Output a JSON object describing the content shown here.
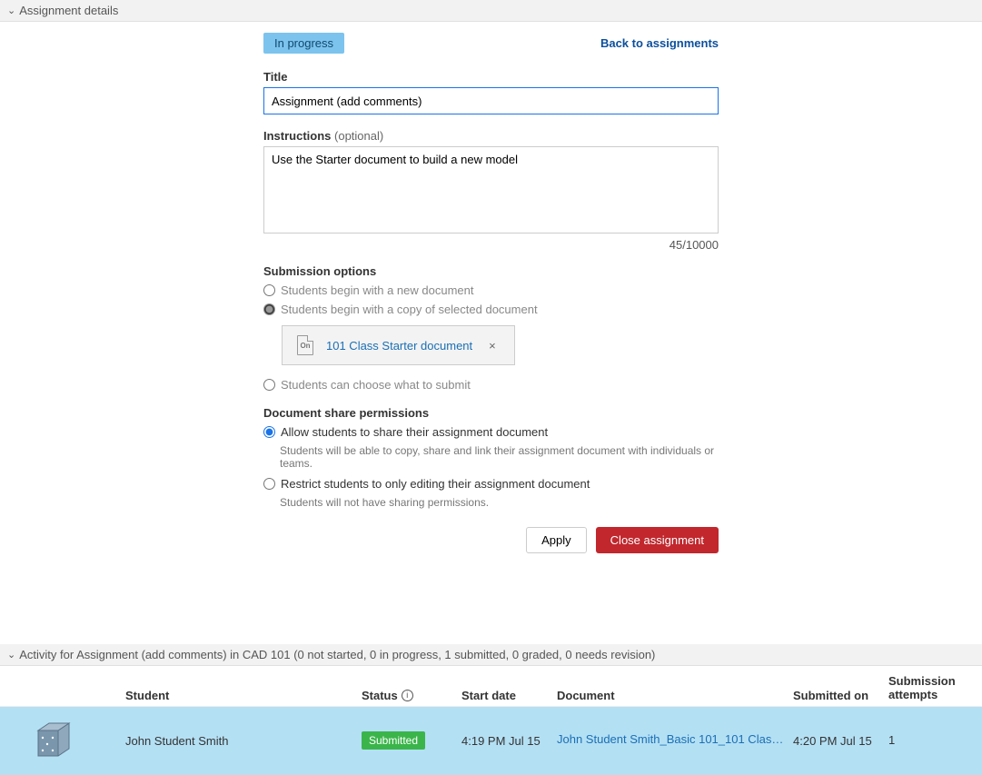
{
  "details": {
    "section_title": "Assignment details",
    "status_chip": "In progress",
    "back_link": "Back to assignments",
    "title_label": "Title",
    "title_value": "Assignment (add comments)",
    "instructions_label": "Instructions",
    "instructions_optional": " (optional)",
    "instructions_value": "Use the Starter document to build a new model",
    "char_count": "45/10000",
    "submission_label": "Submission options",
    "opt_new": "Students begin with a new document",
    "opt_copy": "Students begin with a copy of selected document",
    "opt_choose": "Students can choose what to submit",
    "selected_doc_name": "101 Class Starter document",
    "doc_icon_text": "On",
    "share_label": "Document share permissions",
    "share_allow": "Allow students to share their assignment document",
    "share_allow_help": "Students will be able to copy, share and link their assignment document with individuals or teams.",
    "share_restrict": "Restrict students to only editing their assignment document",
    "share_restrict_help": "Students will not have sharing permissions.",
    "apply_label": "Apply",
    "close_label": "Close assignment"
  },
  "activity": {
    "section_title": "Activity for Assignment (add comments) in CAD 101 (0 not started, 0 in progress, 1 submitted, 0 graded, 0 needs revision)",
    "columns": {
      "student": "Student",
      "status": "Status",
      "start": "Start date",
      "document": "Document",
      "submitted": "Submitted on",
      "attempts": "Submission attempts"
    },
    "rows": [
      {
        "student": "John Student Smith",
        "status": "Submitted",
        "start": "4:19 PM Jul 15",
        "document": "John Student Smith_Basic 101_101 Class Start...",
        "submitted": "4:20 PM Jul 15",
        "attempts": "1"
      }
    ]
  }
}
